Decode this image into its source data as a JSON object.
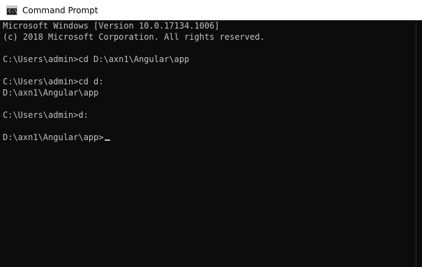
{
  "window": {
    "title": "Command Prompt",
    "icon": "cmd-icon",
    "icon_glyph": "C:\\"
  },
  "console": {
    "lines": [
      "Microsoft Windows [Version 10.0.17134.1006]",
      "(c) 2018 Microsoft Corporation. All rights reserved.",
      "",
      "C:\\Users\\admin>cd D:\\axn1\\Angular\\app",
      "",
      "C:\\Users\\admin>cd d:",
      "D:\\axn1\\Angular\\app",
      "",
      "C:\\Users\\admin>d:",
      "",
      "D:\\axn1\\Angular\\app>"
    ],
    "colors": {
      "background": "#0c0c0c",
      "text": "#c0c0c0"
    }
  }
}
